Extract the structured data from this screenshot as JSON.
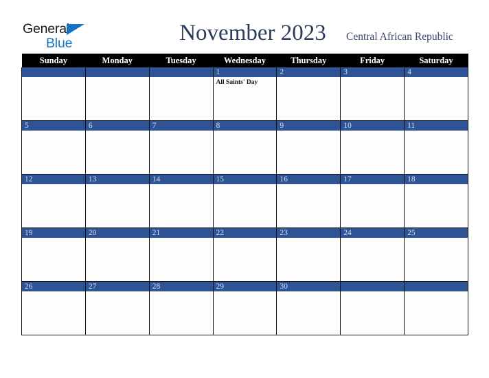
{
  "brand": {
    "name_part1": "General",
    "name_part2": "Blue",
    "accent_color": "#1274c4",
    "triangle_icon": "triangle-icon"
  },
  "header": {
    "title": "November 2023",
    "country": "Central African Republic",
    "title_color": "#2c3a5c"
  },
  "calendar": {
    "month": "November",
    "year": "2023",
    "header_bg": "#000000",
    "daybar_bg": "#2f5496",
    "day_names": [
      "Sunday",
      "Monday",
      "Tuesday",
      "Wednesday",
      "Thursday",
      "Friday",
      "Saturday"
    ],
    "weeks": [
      [
        {
          "date": "",
          "events": []
        },
        {
          "date": "",
          "events": []
        },
        {
          "date": "",
          "events": []
        },
        {
          "date": "1",
          "events": [
            "All Saints' Day"
          ]
        },
        {
          "date": "2",
          "events": []
        },
        {
          "date": "3",
          "events": []
        },
        {
          "date": "4",
          "events": []
        }
      ],
      [
        {
          "date": "5",
          "events": []
        },
        {
          "date": "6",
          "events": []
        },
        {
          "date": "7",
          "events": []
        },
        {
          "date": "8",
          "events": []
        },
        {
          "date": "9",
          "events": []
        },
        {
          "date": "10",
          "events": []
        },
        {
          "date": "11",
          "events": []
        }
      ],
      [
        {
          "date": "12",
          "events": []
        },
        {
          "date": "13",
          "events": []
        },
        {
          "date": "14",
          "events": []
        },
        {
          "date": "15",
          "events": []
        },
        {
          "date": "16",
          "events": []
        },
        {
          "date": "17",
          "events": []
        },
        {
          "date": "18",
          "events": []
        }
      ],
      [
        {
          "date": "19",
          "events": []
        },
        {
          "date": "20",
          "events": []
        },
        {
          "date": "21",
          "events": []
        },
        {
          "date": "22",
          "events": []
        },
        {
          "date": "23",
          "events": []
        },
        {
          "date": "24",
          "events": []
        },
        {
          "date": "25",
          "events": []
        }
      ],
      [
        {
          "date": "26",
          "events": []
        },
        {
          "date": "27",
          "events": []
        },
        {
          "date": "28",
          "events": []
        },
        {
          "date": "29",
          "events": []
        },
        {
          "date": "30",
          "events": []
        },
        {
          "date": "",
          "events": []
        },
        {
          "date": "",
          "events": []
        }
      ]
    ]
  }
}
